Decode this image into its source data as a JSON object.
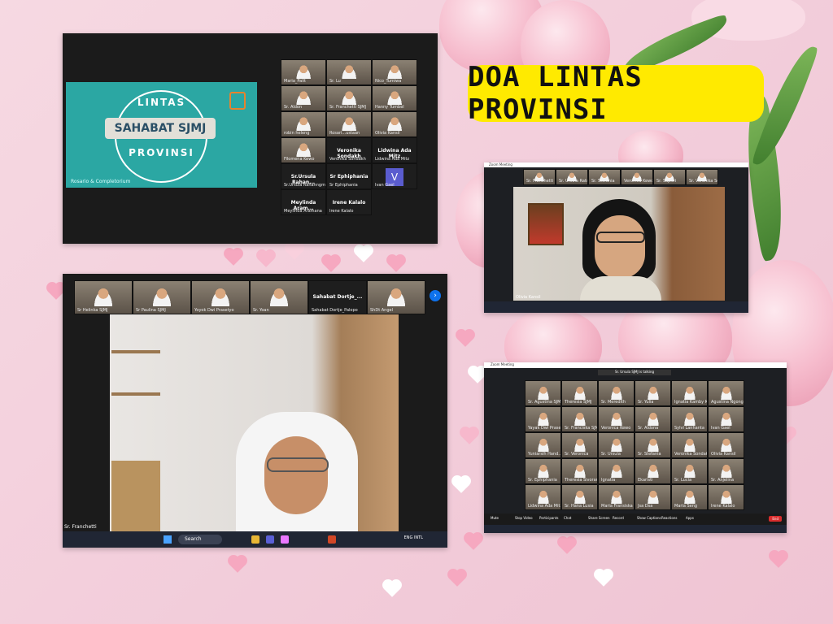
{
  "title": "DOA LINTAS PROVINSI",
  "shot1": {
    "slide": {
      "line1": "LINTAS",
      "line2": "SAHABAT SJMJ",
      "line3": "PROVINSI",
      "subtitle": "Rosario & Completorium"
    },
    "participants": [
      {
        "name": "Maria_Palit"
      },
      {
        "name": "Sr. Lu"
      },
      {
        "name": "Nico_Tumiwa"
      },
      {
        "name": "Sr. Aldon"
      },
      {
        "name": "Sr. Franchetti SJMJ"
      },
      {
        "name": "Hanny Tumbel"
      },
      {
        "name": "robin heleng"
      },
      {
        "name": "Rosari...ustaan"
      },
      {
        "name": "Olivia Kansil"
      },
      {
        "name": "Filomena Kewo"
      },
      {
        "name": "Veronika Sondakh",
        "sub": "Veronika Sondakh",
        "blank": true
      },
      {
        "name": "Lidwina Ada Mitz",
        "sub": "Lidwina Ada Mitz",
        "blank": true
      },
      {
        "name": "Sr.Ursula Rahan...",
        "sub": "Sr.Ursula Rahanngmeh",
        "blank": true
      },
      {
        "name": "Sr Ephiphania",
        "sub": "Sr Ephiphania",
        "blank": true
      },
      {
        "name": "V",
        "sub": "Ivan Gael",
        "avatar": true
      },
      {
        "name": "Meylinda Aram...",
        "sub": "Meylinda Aramana",
        "blank": true
      },
      {
        "name": "Irene Kalalo",
        "sub": "Irene Kalalo",
        "blank": true
      }
    ]
  },
  "shot2": {
    "window_title": "Zoom Meeting",
    "strip": [
      "Sr. Franchetti",
      "Sr. Ursula Ratuan",
      "Sr. Stefania",
      "Veronica Kewo",
      "Sr. Sapitri",
      "Sr. Veronika Sondakh"
    ],
    "speaker": "Olivia Kansil"
  },
  "shot3": {
    "strip": [
      {
        "name": "Sr Helinka SJMJ"
      },
      {
        "name": "Sr Paulina SJMJ"
      },
      {
        "name": "Yoyok Dwi Prasetyo"
      },
      {
        "name": "Sr. Yoan"
      },
      {
        "name": "Sahabat Dortje_...",
        "sub": "Sahabat Dortje_Palopo",
        "blank": true
      },
      {
        "name": "ShDt Angel"
      }
    ],
    "speaker": "Sr. Franchetti",
    "taskbar": {
      "search": "Search",
      "lang": "ENG INTL"
    }
  },
  "shot4": {
    "window_title": "Zoom Meeting",
    "speaking": "Sr. Ursula SJMJ is talking",
    "participants": [
      "Sr. Agustina SJMJ",
      "Theresia SJMJ",
      "Sr. Meredith",
      "Sr. Yulia",
      "Ignatia Kamby Kurniawan",
      "Agustina Ngonglesang",
      "Yayak Dwi Prasetyo",
      "Sr. Franciska SJMJ",
      "Veronica Kewo",
      "Sr. Aldona",
      "Sylvi Lanhanta",
      "Ivan Gael",
      "Yuniarsih Hand...",
      "Sr. Veronica",
      "Sr. Ursula",
      "Sr. Stefania",
      "Veronika Sondakh",
      "Olivia Kansil",
      "Sr. Ephiphania",
      "Theresia Sivoranna",
      "Ignatia",
      "Ekaristi",
      "Sr. Lucia",
      "Sr. Anjelina",
      "Lidwina Ada Mitz",
      "Sr. Hana Lusia",
      "Maria Fransiska",
      "Jsa Dsa",
      "Maria Seng",
      "Irene Kalalo"
    ],
    "controls": [
      "Mute",
      "Stop Video",
      "Participants",
      "Chat",
      "Share Screen",
      "Record",
      "Show Captions",
      "Reactions",
      "Apps",
      "End"
    ]
  }
}
